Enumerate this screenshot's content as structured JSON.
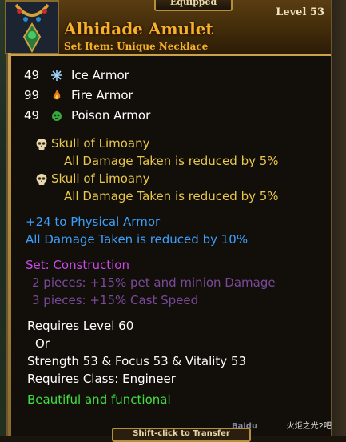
{
  "header": {
    "equipped_label": "Equipped",
    "item_name": "Alhidade Amulet",
    "item_subtitle": "Set Item: Unique Necklace",
    "level": "Level 53",
    "name_color": "#f6b02a"
  },
  "armor": [
    {
      "value": "49",
      "icon": "ice-icon",
      "label": "Ice Armor"
    },
    {
      "value": "99",
      "icon": "fire-icon",
      "label": "Fire Armor"
    },
    {
      "value": "49",
      "icon": "poison-icon",
      "label": "Poison Armor"
    }
  ],
  "sockets": [
    {
      "icon": "skull-icon",
      "name": "Skull of Limoany",
      "effect": "All Damage Taken is reduced by 5%"
    },
    {
      "icon": "skull-icon",
      "name": "Skull of Limoany",
      "effect": "All Damage Taken is reduced by 5%"
    }
  ],
  "bonuses": [
    "+24 to Physical Armor",
    "All Damage Taken is reduced by 10%"
  ],
  "set": {
    "title": "Set: Construction",
    "pieces": [
      "2 pieces: +15% pet and minion Damage",
      "3 pieces: +15% Cast Speed"
    ]
  },
  "requirements": {
    "level": "Requires Level 60",
    "or": "Or",
    "stats": "Strength 53 & Focus 53 & Vitality 53",
    "class": "Requires Class: Engineer"
  },
  "flavor": "Beautiful and functional",
  "footer": {
    "hint": "Shift-click to Transfer"
  },
  "watermark": {
    "site": "Baidu",
    "forum": "火炬之光2吧"
  },
  "colors": {
    "yellow": "#e9c84a",
    "blue": "#3aa0ff",
    "purple": "#c84ae8",
    "green": "#3fe03f"
  }
}
